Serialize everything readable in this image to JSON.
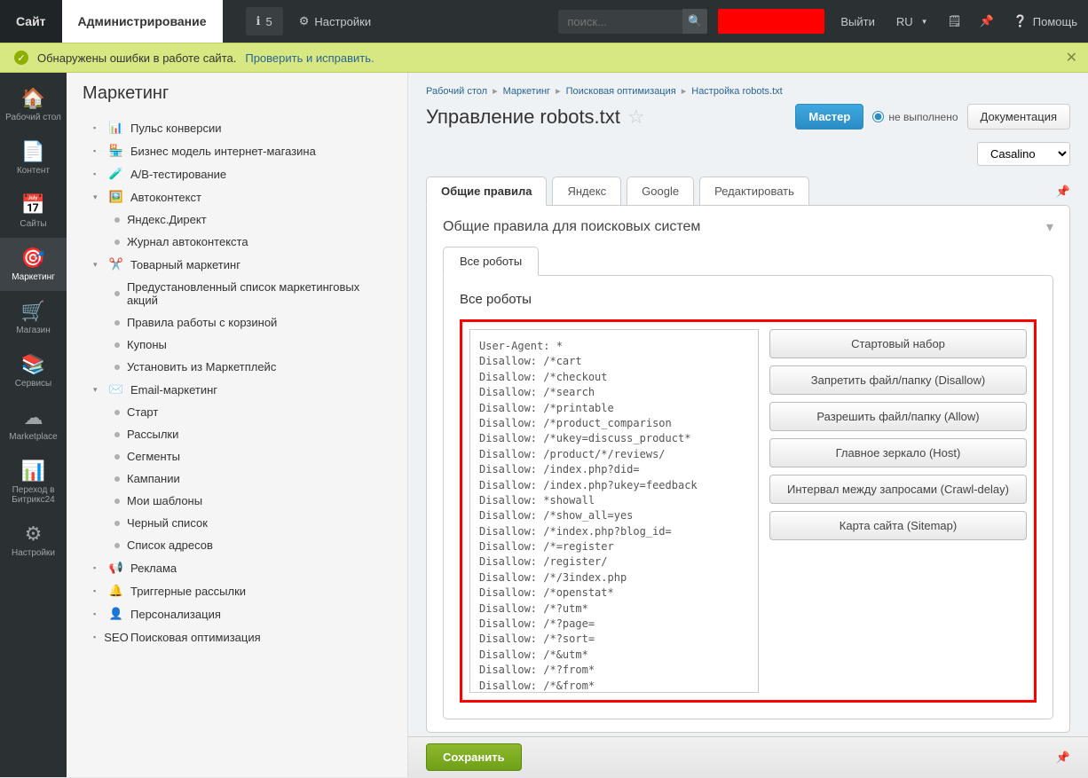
{
  "topbar": {
    "site_tab": "Сайт",
    "admin_tab": "Администрирование",
    "notif_count": "5",
    "settings": "Настройки",
    "search_placeholder": "поиск...",
    "logout": "Выйти",
    "lang": "RU",
    "help": "Помощь"
  },
  "notice": {
    "text": "Обнаружены ошибки в работе сайта.",
    "link": "Проверить и исправить."
  },
  "rail": [
    {
      "label": "Рабочий стол",
      "icon": "home"
    },
    {
      "label": "Контент",
      "icon": "doc"
    },
    {
      "label": "Сайты",
      "icon": "cal"
    },
    {
      "label": "Маркетинг",
      "icon": "target",
      "active": true
    },
    {
      "label": "Магазин",
      "icon": "cart"
    },
    {
      "label": "Сервисы",
      "icon": "layers"
    },
    {
      "label": "Marketplace",
      "icon": "cloud"
    },
    {
      "label": "Переход в Битрикс24",
      "icon": "b24"
    },
    {
      "label": "Настройки",
      "icon": "gear"
    }
  ],
  "tree": {
    "title": "Маркетинг",
    "items": [
      {
        "l": 1,
        "exp": "-",
        "ic": "📊",
        "label": "Пульс конверсии"
      },
      {
        "l": 1,
        "exp": "-",
        "ic": "🏪",
        "label": "Бизнес модель интернет-магазина"
      },
      {
        "l": 1,
        "exp": "-",
        "ic": "🧪",
        "label": "A/B-тестирование"
      },
      {
        "l": 1,
        "exp": "▾",
        "ic": "🖼️",
        "label": "Автоконтекст"
      },
      {
        "l": 2,
        "dot": true,
        "label": "Яндекс.Директ"
      },
      {
        "l": 2,
        "dot": true,
        "label": "Журнал автоконтекста"
      },
      {
        "l": 1,
        "exp": "▾",
        "ic": "✂️",
        "label": "Товарный маркетинг"
      },
      {
        "l": 2,
        "dot": true,
        "label": "Предустановленный список маркетинговых акций"
      },
      {
        "l": 2,
        "dot": true,
        "label": "Правила работы с корзиной"
      },
      {
        "l": 2,
        "dot": true,
        "label": "Купоны"
      },
      {
        "l": 2,
        "dot": true,
        "label": "Установить из Маркетплейс"
      },
      {
        "l": 1,
        "exp": "▾",
        "ic": "✉️",
        "label": "Email-маркетинг"
      },
      {
        "l": 2,
        "dot": true,
        "label": "Старт"
      },
      {
        "l": 2,
        "dot": true,
        "label": "Рассылки"
      },
      {
        "l": 2,
        "dot": true,
        "label": "Сегменты"
      },
      {
        "l": 2,
        "dot": true,
        "label": "Кампании"
      },
      {
        "l": 2,
        "dot": true,
        "label": "Мои шаблоны"
      },
      {
        "l": 2,
        "dot": true,
        "label": "Черный список"
      },
      {
        "l": 2,
        "dot": true,
        "label": "Список адресов"
      },
      {
        "l": 1,
        "exp": "-",
        "ic": "📢",
        "label": "Реклама"
      },
      {
        "l": 1,
        "exp": "-",
        "ic": "🔔",
        "label": "Триггерные рассылки"
      },
      {
        "l": 1,
        "exp": "-",
        "ic": "👤",
        "label": "Персонализация"
      },
      {
        "l": 1,
        "exp": "-",
        "ic": "SEO",
        "label": "Поисковая оптимизация"
      }
    ]
  },
  "breadcrumb": [
    "Рабочий стол",
    "Маркетинг",
    "Поисковая оптимизация",
    "Настройка robots.txt"
  ],
  "page": {
    "title": "Управление robots.txt",
    "master_btn": "Мастер",
    "status_label": "не выполнено",
    "doc_btn": "Документация",
    "site_selected": "Casalino"
  },
  "tabs": [
    "Общие правила",
    "Яндекс",
    "Google",
    "Редактировать"
  ],
  "panel": {
    "title": "Общие правила для поисковых систем",
    "inner_tab": "Все роботы",
    "inner_heading": "Все роботы"
  },
  "robots_txt": "User-Agent: *\nDisallow: /*cart\nDisallow: /*checkout\nDisallow: /*search\nDisallow: /*printable\nDisallow: /*product_comparison\nDisallow: /*ukey=discuss_product*\nDisallow: /product/*/reviews/\nDisallow: /index.php?did=\nDisallow: /index.php?ukey=feedback\nDisallow: *showall\nDisallow: /*show_all=yes\nDisallow: /*index.php?blog_id=\nDisallow: /*=register\nDisallow: /register/\nDisallow: /*/3index.php\nDisallow: /*openstat*\nDisallow: /*?utm*\nDisallow: /*?page=\nDisallow: /*?sort=\nDisallow: /*&utm*\nDisallow: /*?from*\nDisallow: /*&from*\nDisallow: /*gclid*\nDisallow: /*yclid*\nDisallow: /*ymclid*\nDisallow: /*?tid*\nDisallow: /*&tid*\nDisallow: /tag/\nDisallow: /my-account/\nDisallow: /logout/",
  "action_buttons": [
    "Стартовый набор",
    "Запретить файл/папку (Disallow)",
    "Разрешить файл/папку (Allow)",
    "Главное зеркало (Host)",
    "Интервал между запросами (Crawl-delay)",
    "Карта сайта (Sitemap)"
  ],
  "save_btn": "Сохранить"
}
